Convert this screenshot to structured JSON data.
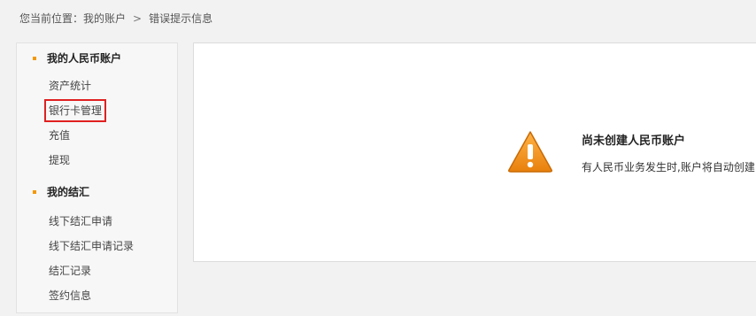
{
  "breadcrumb": {
    "prefix": "您当前位置：",
    "level1": "我的账户",
    "separator": ">",
    "level2": "错误提示信息"
  },
  "sidebar": {
    "groups": [
      {
        "title": "我的人民币账户",
        "items": [
          {
            "label": "资产统计"
          },
          {
            "label": "银行卡管理",
            "highlighted": true
          },
          {
            "label": "充值"
          },
          {
            "label": "提现"
          }
        ]
      },
      {
        "title": "我的结汇",
        "items": [
          {
            "label": "线下结汇申请"
          },
          {
            "label": "线下结汇申请记录"
          },
          {
            "label": "结汇记录"
          },
          {
            "label": "签约信息"
          }
        ]
      }
    ]
  },
  "message": {
    "icon": "warning-icon",
    "title": "尚未创建人民币账户",
    "text": "有人民币业务发生时,账户将自动创建"
  },
  "colors": {
    "accent": "#f39800",
    "highlight_border": "#e02020",
    "warning_icon": "#f0901e"
  }
}
